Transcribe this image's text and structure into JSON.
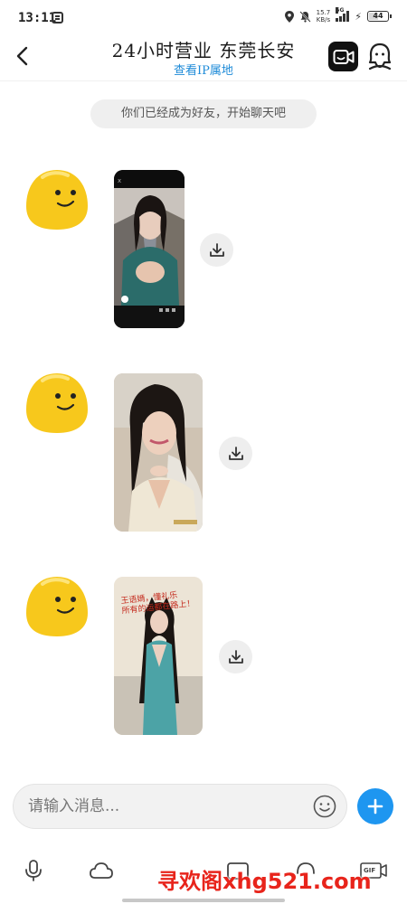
{
  "status_bar": {
    "time": "13:11",
    "network_speed_value": "15.7",
    "network_speed_unit": "KB/s",
    "network_type": "5G",
    "battery": "44",
    "battery_level": 0.44
  },
  "header": {
    "title": "24小时营业 东莞长安",
    "subtitle": "查看IP属地"
  },
  "notice": "你们已经成为好友，开始聊天吧",
  "messages": [
    {
      "type": "video",
      "sender": "contact"
    },
    {
      "type": "video",
      "sender": "contact"
    },
    {
      "type": "video",
      "sender": "contact"
    }
  ],
  "media_captions": {
    "video3_top": "王语嫣，懂礼乐",
    "video3_mid": "所有的运都在路上！"
  },
  "composer": {
    "placeholder": "请输入消息..."
  },
  "toolbar": {
    "gif_label": "GIF"
  },
  "watermark": "寻欢阁xhg521.com",
  "colors": {
    "accent": "#1e96f0",
    "subtitle": "#1e8bd8",
    "avatar": "#f7c81c",
    "watermark": "#e8241b"
  },
  "icons": {
    "back": "chevron-left-icon",
    "video_call": "video-camera-icon",
    "profile": "user-profile-icon",
    "download": "download-icon",
    "emoji": "smiley-icon",
    "send": "plus-icon",
    "voice": "microphone-icon",
    "cloud": "cloud-icon",
    "gif": "gif-icon"
  }
}
